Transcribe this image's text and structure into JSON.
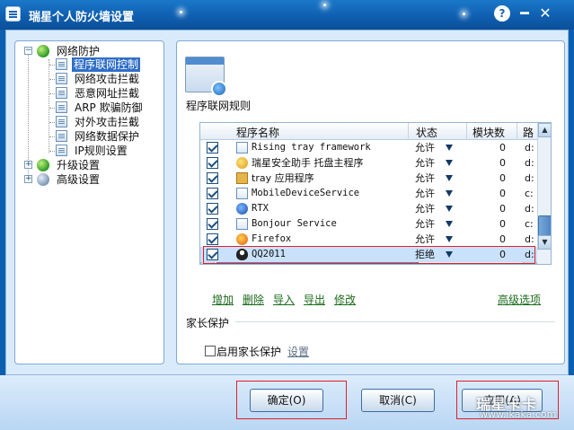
{
  "window": {
    "title": "瑞星个人防火墙设置",
    "help": "?",
    "minimize": "━",
    "close": "✕"
  },
  "tree": {
    "root1": {
      "toggle": "−",
      "label": "网络防护"
    },
    "children": [
      "程序联网控制",
      "网络攻击拦截",
      "恶意网址拦截",
      "ARP 欺骗防御",
      "对外攻击拦截",
      "网络数据保护",
      "IP规则设置"
    ],
    "root2": {
      "toggle": "+",
      "label": "升级设置"
    },
    "root3": {
      "toggle": "+",
      "label": "高级设置"
    }
  },
  "panel": {
    "section_title": "程序联网规则"
  },
  "grid": {
    "headers": {
      "name": "程序名称",
      "status": "状态",
      "modules": "模块数",
      "path": "路"
    },
    "rows": [
      {
        "name": "Rising tray framework",
        "status": "允许",
        "modules": "0",
        "path": "d:",
        "icon": "doc-icon"
      },
      {
        "name": "瑞星安全助手 托盘主程序",
        "status": "允许",
        "modules": "0",
        "path": "d:",
        "icon": "rising-icon"
      },
      {
        "name": "tray 应用程序",
        "status": "允许",
        "modules": "0",
        "path": "d:",
        "icon": "tray-icon"
      },
      {
        "name": "MobileDeviceService",
        "status": "允许",
        "modules": "0",
        "path": "c:",
        "icon": "doc-icon"
      },
      {
        "name": "RTX",
        "status": "允许",
        "modules": "0",
        "path": "d:",
        "icon": "rtx-icon"
      },
      {
        "name": "Bonjour Service",
        "status": "允许",
        "modules": "0",
        "path": "c:",
        "icon": "doc-icon"
      },
      {
        "name": "Firefox",
        "status": "允许",
        "modules": "0",
        "path": "d:",
        "icon": "firefox-icon"
      },
      {
        "name": "QQ2011",
        "status": "拒绝",
        "modules": "0",
        "path": "d:",
        "icon": "qq-icon"
      }
    ]
  },
  "actions": {
    "add": "增加",
    "delete": "删除",
    "import": "导入",
    "export": "导出",
    "modify": "修改",
    "advanced": "高级选项"
  },
  "parental": {
    "title": "家长保护",
    "checkbox_label": "启用家长保护",
    "settings_link": "设置"
  },
  "footer": {
    "ok": "确定(O)",
    "cancel": "取消(C)",
    "apply": "应用(A)"
  },
  "watermark": {
    "brand": "瑞星卡卡",
    "url": "www.ikaka.com"
  },
  "colors": {
    "title_bar": "#0f5fb0",
    "selection": "#2f6ec7",
    "highlight_box": "#e0202a",
    "link": "#1a6b1a"
  }
}
